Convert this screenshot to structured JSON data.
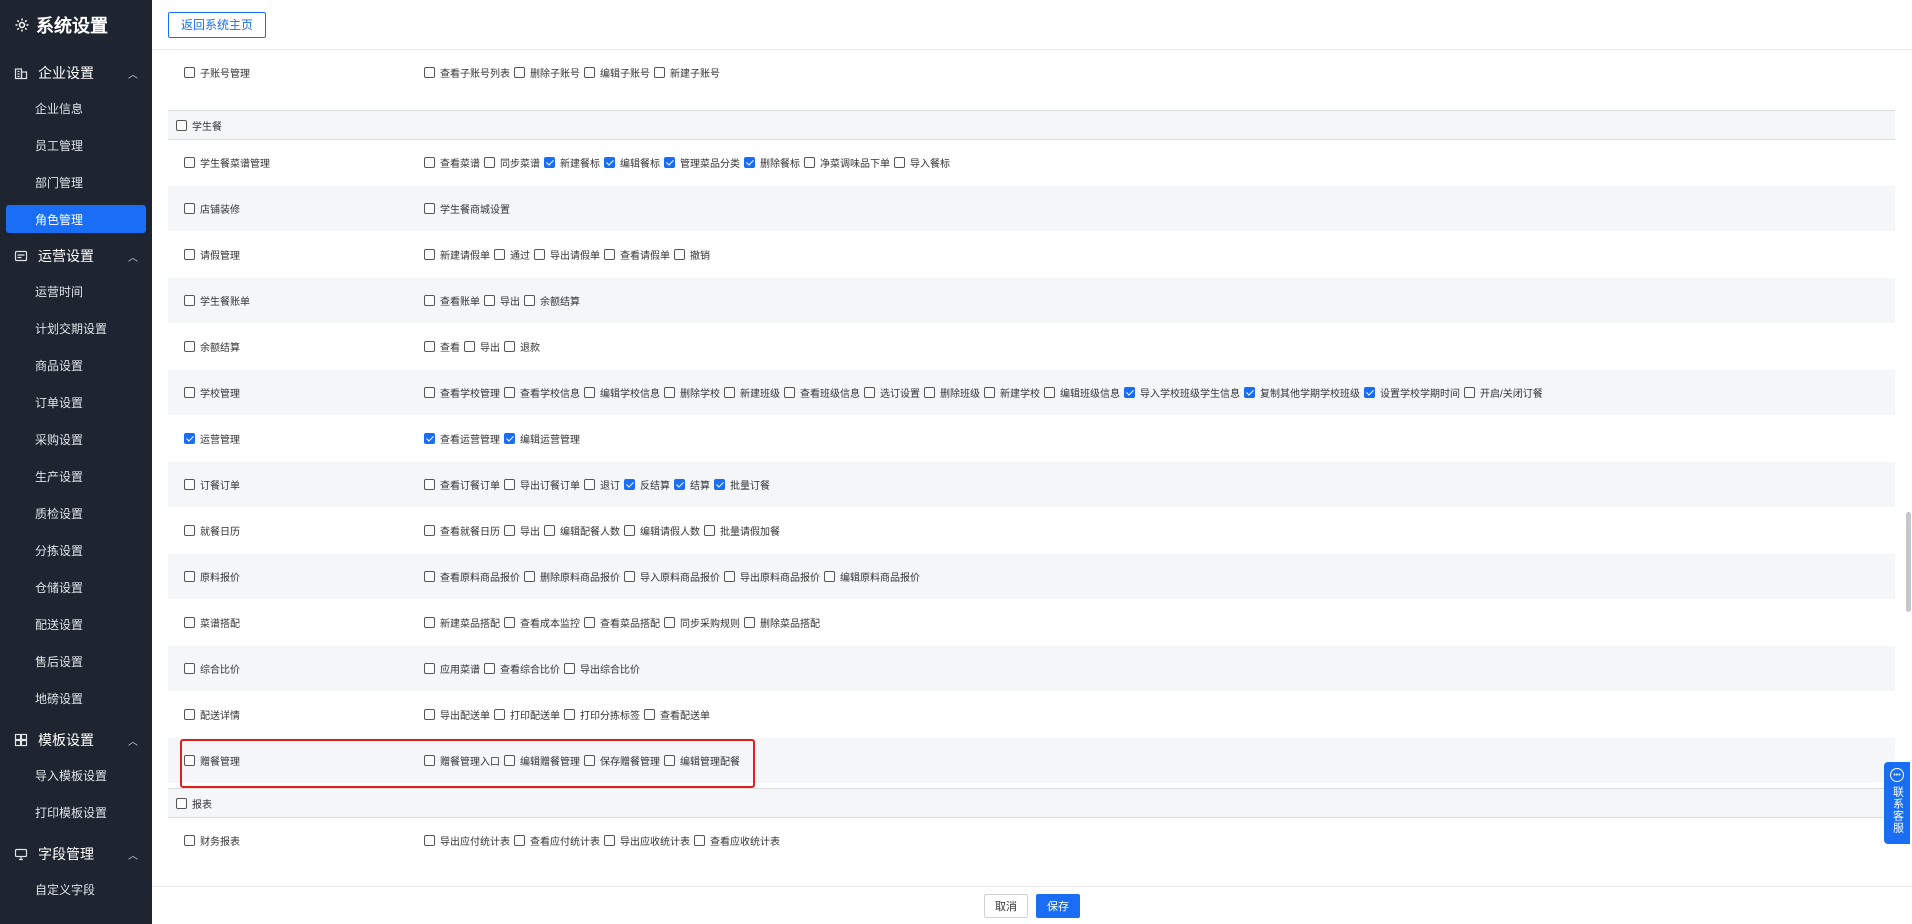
{
  "sidebar": {
    "title": "系统设置",
    "groups": [
      {
        "label": "企业设置",
        "icon": "building-icon",
        "items": [
          "企业信息",
          "员工管理",
          "部门管理",
          "角色管理"
        ]
      },
      {
        "label": "运营设置",
        "icon": "card-icon",
        "items": [
          "运营时间",
          "计划交期设置",
          "商品设置",
          "订单设置",
          "采购设置",
          "生产设置",
          "质检设置",
          "分拣设置",
          "仓储设置",
          "配送设置",
          "售后设置",
          "地磅设置"
        ]
      },
      {
        "label": "模板设置",
        "icon": "template-icon",
        "items": [
          "导入模板设置",
          "打印模板设置"
        ]
      },
      {
        "label": "字段管理",
        "icon": "field-icon",
        "items": [
          "自定义字段"
        ]
      }
    ],
    "active_item": "角色管理"
  },
  "topbar": {
    "back_label": "返回系统主页"
  },
  "rows_top": [
    {
      "label": "子账号管理",
      "checked": false,
      "perms": [
        {
          "label": "查看子账号列表",
          "checked": false
        },
        {
          "label": "删除子账号",
          "checked": false
        },
        {
          "label": "编辑子账号",
          "checked": false
        },
        {
          "label": "新建子账号",
          "checked": false
        }
      ]
    }
  ],
  "section_student": {
    "label": "学生餐",
    "checked": false
  },
  "rows_student": [
    {
      "label": "学生餐菜谱管理",
      "checked": false,
      "perms": [
        {
          "label": "查看菜谱",
          "checked": false
        },
        {
          "label": "同步菜谱",
          "checked": false
        },
        {
          "label": "新建餐标",
          "checked": true
        },
        {
          "label": "编辑餐标",
          "checked": true
        },
        {
          "label": "管理菜品分类",
          "checked": true
        },
        {
          "label": "删除餐标",
          "checked": true
        },
        {
          "label": "净菜调味品下单",
          "checked": false
        },
        {
          "label": "导入餐标",
          "checked": false
        }
      ]
    },
    {
      "label": "店铺装修",
      "checked": false,
      "perms": [
        {
          "label": "学生餐商城设置",
          "checked": false
        }
      ]
    },
    {
      "label": "请假管理",
      "checked": false,
      "perms": [
        {
          "label": "新建请假单",
          "checked": false
        },
        {
          "label": "通过",
          "checked": false
        },
        {
          "label": "导出请假单",
          "checked": false
        },
        {
          "label": "查看请假单",
          "checked": false
        },
        {
          "label": "撤销",
          "checked": false
        }
      ]
    },
    {
      "label": "学生餐账单",
      "checked": false,
      "perms": [
        {
          "label": "查看账单",
          "checked": false
        },
        {
          "label": "导出",
          "checked": false
        },
        {
          "label": "余额结算",
          "checked": false
        }
      ]
    },
    {
      "label": "余额结算",
      "checked": false,
      "perms": [
        {
          "label": "查看",
          "checked": false
        },
        {
          "label": "导出",
          "checked": false
        },
        {
          "label": "退款",
          "checked": false
        }
      ]
    },
    {
      "label": "学校管理",
      "checked": false,
      "perms": [
        {
          "label": "查看学校管理",
          "checked": false
        },
        {
          "label": "查看学校信息",
          "checked": false
        },
        {
          "label": "编辑学校信息",
          "checked": false
        },
        {
          "label": "删除学校",
          "checked": false
        },
        {
          "label": "新建班级",
          "checked": false
        },
        {
          "label": "查看班级信息",
          "checked": false
        },
        {
          "label": "选订设置",
          "checked": false
        },
        {
          "label": "删除班级",
          "checked": false
        },
        {
          "label": "新建学校",
          "checked": false
        },
        {
          "label": "编辑班级信息",
          "checked": false
        },
        {
          "label": "导入学校班级学生信息",
          "checked": true
        },
        {
          "label": "复制其他学期学校班级",
          "checked": true
        },
        {
          "label": "设置学校学期时间",
          "checked": true
        },
        {
          "label": "开启/关闭订餐",
          "checked": false
        }
      ]
    },
    {
      "label": "运营管理",
      "checked": true,
      "perms": [
        {
          "label": "查看运营管理",
          "checked": true
        },
        {
          "label": "编辑运营管理",
          "checked": true
        }
      ]
    },
    {
      "label": "订餐订单",
      "checked": false,
      "perms": [
        {
          "label": "查看订餐订单",
          "checked": false
        },
        {
          "label": "导出订餐订单",
          "checked": false
        },
        {
          "label": "退订",
          "checked": false
        },
        {
          "label": "反结算",
          "checked": true
        },
        {
          "label": "结算",
          "checked": true
        },
        {
          "label": "批量订餐",
          "checked": true
        }
      ]
    },
    {
      "label": "就餐日历",
      "checked": false,
      "perms": [
        {
          "label": "查看就餐日历",
          "checked": false
        },
        {
          "label": "导出",
          "checked": false
        },
        {
          "label": "编辑配餐人数",
          "checked": false
        },
        {
          "label": "编辑请假人数",
          "checked": false
        },
        {
          "label": "批量请假加餐",
          "checked": false
        }
      ]
    },
    {
      "label": "原料报价",
      "checked": false,
      "perms": [
        {
          "label": "查看原料商品报价",
          "checked": false
        },
        {
          "label": "删除原料商品报价",
          "checked": false
        },
        {
          "label": "导入原料商品报价",
          "checked": false
        },
        {
          "label": "导出原料商品报价",
          "checked": false
        },
        {
          "label": "编辑原料商品报价",
          "checked": false
        }
      ]
    },
    {
      "label": "菜谱搭配",
      "checked": false,
      "perms": [
        {
          "label": "新建菜品搭配",
          "checked": false
        },
        {
          "label": "查看成本监控",
          "checked": false
        },
        {
          "label": "查看菜品搭配",
          "checked": false
        },
        {
          "label": "同步采购规则",
          "checked": false
        },
        {
          "label": "删除菜品搭配",
          "checked": false
        }
      ]
    },
    {
      "label": "综合比价",
      "checked": false,
      "perms": [
        {
          "label": "应用菜谱",
          "checked": false
        },
        {
          "label": "查看综合比价",
          "checked": false
        },
        {
          "label": "导出综合比价",
          "checked": false
        }
      ]
    },
    {
      "label": "配送详情",
      "checked": false,
      "perms": [
        {
          "label": "导出配送单",
          "checked": false
        },
        {
          "label": "打印配送单",
          "checked": false
        },
        {
          "label": "打印分拣标签",
          "checked": false
        },
        {
          "label": "查看配送单",
          "checked": false
        }
      ]
    },
    {
      "label": "赠餐管理",
      "checked": false,
      "perms": [
        {
          "label": "赠餐管理入口",
          "checked": false
        },
        {
          "label": "编辑赠餐管理",
          "checked": false
        },
        {
          "label": "保存赠餐管理",
          "checked": false
        },
        {
          "label": "编辑管理配餐",
          "checked": false
        }
      ]
    }
  ],
  "section_report": {
    "label": "报表",
    "checked": false
  },
  "rows_report": [
    {
      "label": "财务报表",
      "checked": false,
      "perms": [
        {
          "label": "导出应付统计表",
          "checked": false
        },
        {
          "label": "查看应付统计表",
          "checked": false
        },
        {
          "label": "导出应收统计表",
          "checked": false
        },
        {
          "label": "查看应收统计表",
          "checked": false
        }
      ]
    }
  ],
  "footer": {
    "cancel_label": "取消",
    "save_label": "保存"
  },
  "support": {
    "label": "联系客服"
  },
  "colors": {
    "accent": "#1a6ef5",
    "sidebar_bg": "#1e2430",
    "highlight": "#e0201c"
  }
}
